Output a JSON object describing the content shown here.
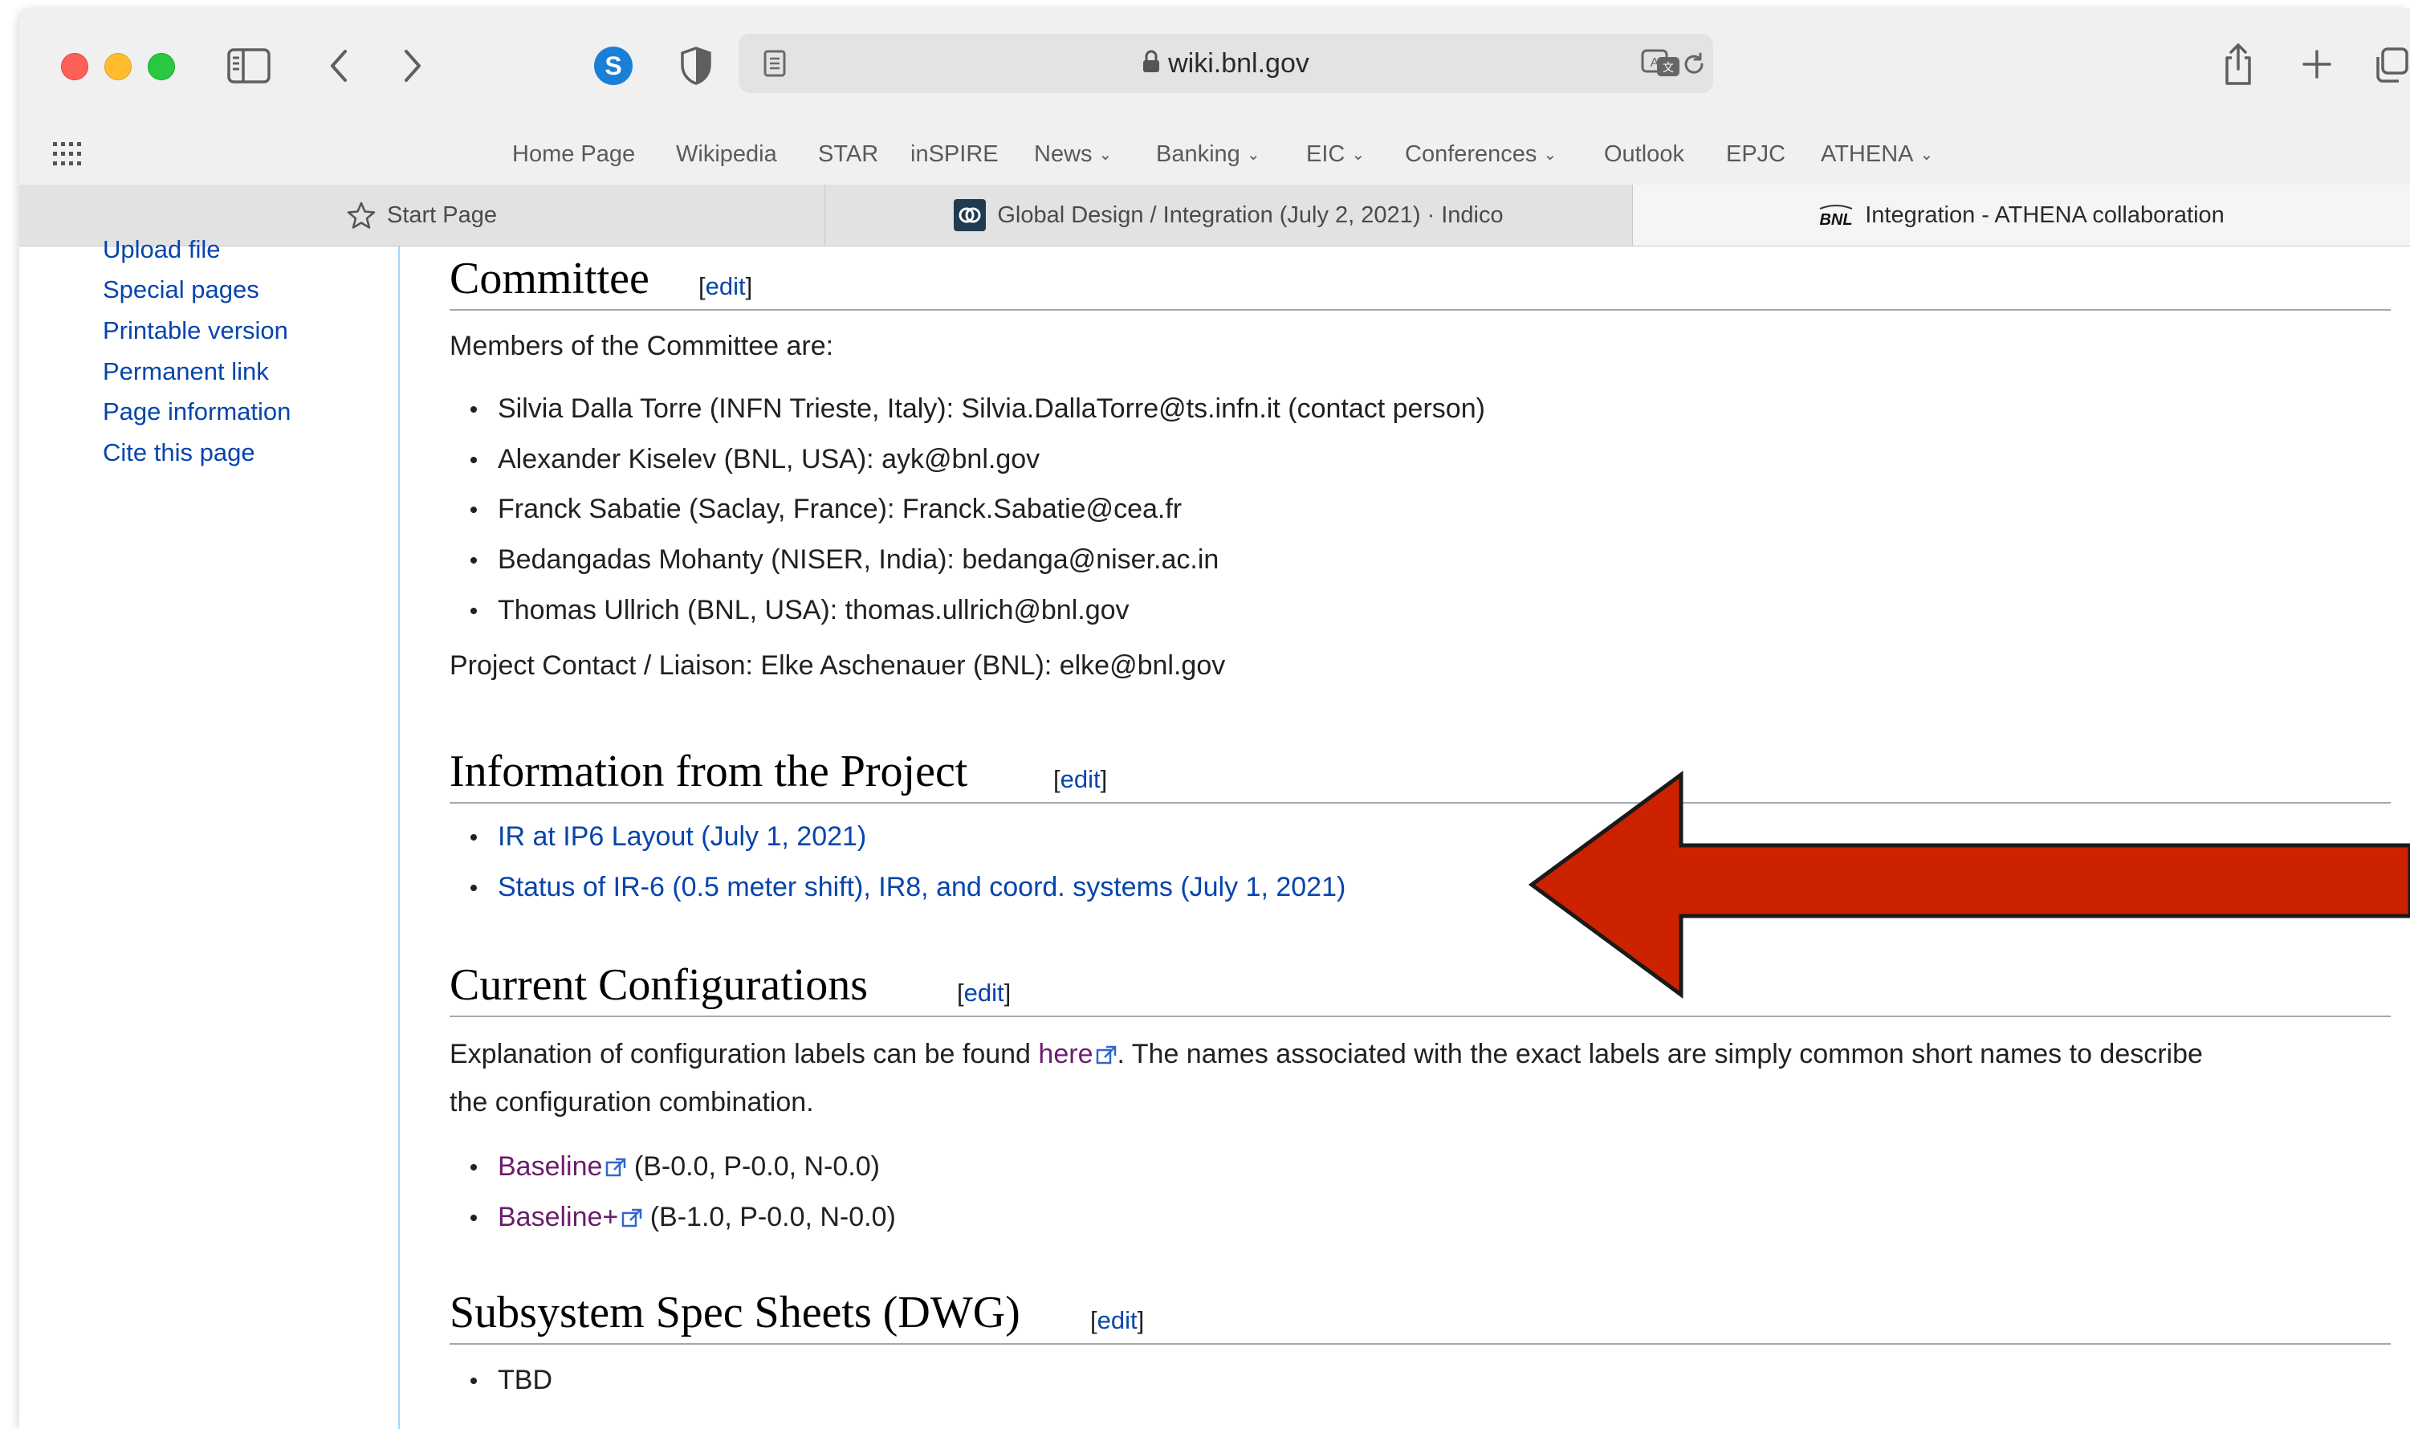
{
  "browser": {
    "url": "wiki.bnl.gov",
    "favorites": [
      {
        "label": "Home Page",
        "menu": false
      },
      {
        "label": "Wikipedia",
        "menu": false
      },
      {
        "label": "STAR",
        "menu": false
      },
      {
        "label": "inSPIRE",
        "menu": false
      },
      {
        "label": "News",
        "menu": true
      },
      {
        "label": "Banking",
        "menu": true
      },
      {
        "label": "EIC",
        "menu": true
      },
      {
        "label": "Conferences",
        "menu": true
      },
      {
        "label": "Outlook",
        "menu": false
      },
      {
        "label": "EPJC",
        "menu": false
      },
      {
        "label": "ATHENA",
        "menu": true
      }
    ],
    "tabs": [
      {
        "label": "Start Page",
        "icon": "star-icon"
      },
      {
        "label": "Global Design / Integration (July 2, 2021) · Indico",
        "icon": "indico-icon"
      },
      {
        "label": "Integration - ATHENA collaboration",
        "icon": "bnl-logo-icon",
        "icon_text": "BNL"
      }
    ]
  },
  "sidebar": {
    "links": [
      "Upload file",
      "Special pages",
      "Printable version",
      "Permanent link",
      "Page information",
      "Cite this page"
    ]
  },
  "main": {
    "edit_label": "edit",
    "committee": {
      "heading": "Committee",
      "intro": "Members of the Committee are:",
      "members": [
        "Silvia Dalla Torre (INFN Trieste, Italy): Silvia.DallaTorre@ts.infn.it (contact person)",
        "Alexander Kiselev (BNL, USA): ayk@bnl.gov",
        "Franck Sabatie (Saclay, France): Franck.Sabatie@cea.fr",
        "Bedangadas Mohanty (NISER, India): bedanga@niser.ac.in",
        "Thomas Ullrich (BNL, USA): thomas.ullrich@bnl.gov"
      ],
      "contact": "Project Contact / Liaison: Elke Aschenauer (BNL): elke@bnl.gov"
    },
    "project_info": {
      "heading": "Information from the Project",
      "links": [
        "IR at IP6 Layout (July 1, 2021)",
        "Status of IR-6 (0.5 meter shift), IR8, and coord. systems (July 1, 2021)"
      ]
    },
    "configurations": {
      "heading": "Current Configurations",
      "text_before": "Explanation of configuration labels can be found ",
      "here_link": "here",
      "text_after": ". The names associated with the exact labels are simply common short names to describe",
      "text_line2": "the configuration combination.",
      "items": [
        {
          "link": "Baseline",
          "detail": " (B-0.0, P-0.0, N-0.0)"
        },
        {
          "link": "Baseline+",
          "detail": " (B-1.0, P-0.0, N-0.0)"
        }
      ]
    },
    "spec_sheets": {
      "heading": "Subsystem Spec Sheets (DWG)",
      "items": [
        "TBD"
      ]
    }
  },
  "annotation": {
    "arrow_color": "#cc2200",
    "arrow_outline": "#1a1a1a"
  }
}
